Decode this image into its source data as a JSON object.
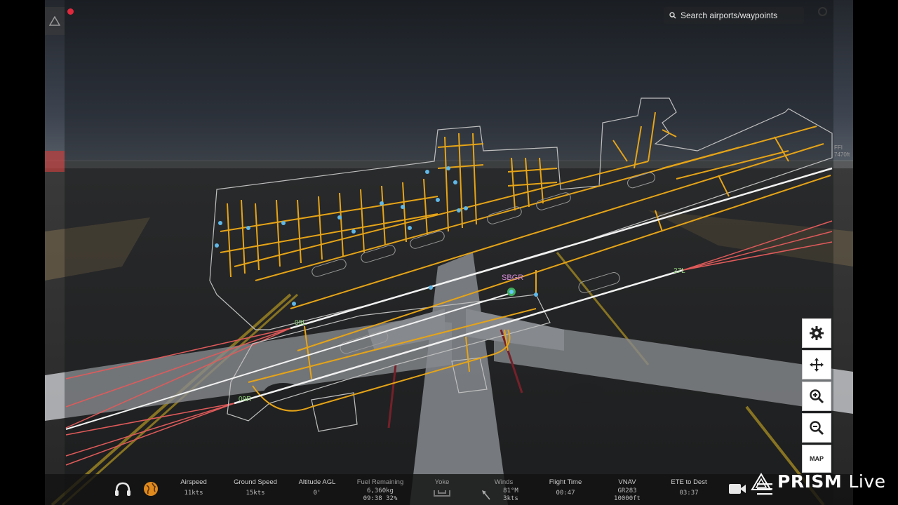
{
  "search": {
    "placeholder": "Search airports/waypoints"
  },
  "map": {
    "airport_code": "SBGR",
    "runway_labels": [
      "09L",
      "09R",
      "27L"
    ],
    "edge_marker": "FFI",
    "edge_altitude": "7470ft"
  },
  "controls": {
    "map_label": "MAP"
  },
  "bottom_bar": {
    "stats": [
      {
        "label": "Airspeed",
        "value": "11kts"
      },
      {
        "label": "Ground Speed",
        "value": "15kts"
      },
      {
        "label": "Altitude AGL",
        "value": "0'"
      },
      {
        "label": "Fuel Remaining",
        "value": "6,360kg",
        "value2": "09:38 32%"
      },
      {
        "label": "Yoke",
        "value": ""
      },
      {
        "label": "Winds",
        "value": "81°M",
        "value2": "3kts"
      },
      {
        "label": "Flight Time",
        "value": "00:47"
      },
      {
        "label": "VNAV",
        "value": "GR283",
        "value2": "10000ft"
      },
      {
        "label": "ETE to Dest",
        "value": "03:37"
      }
    ]
  },
  "watermark": {
    "brand": "PRISM",
    "suffix": "Live"
  },
  "colors": {
    "taxiway": "#e6a417",
    "runway": "#f2f2f2",
    "approach": "#e05a5a",
    "airport": "#d58ad8",
    "accent": "#e08a1e"
  }
}
